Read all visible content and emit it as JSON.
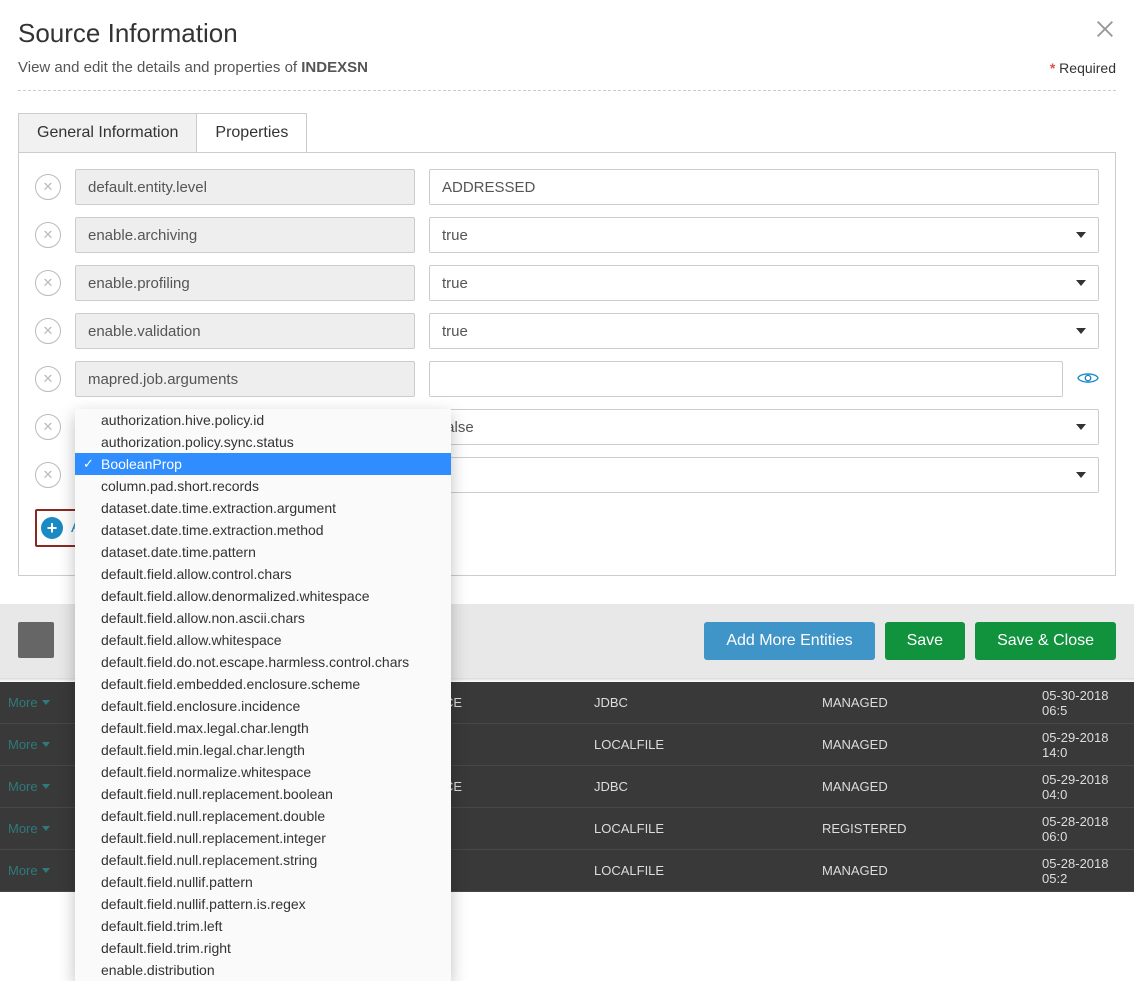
{
  "header": {
    "title": "Source Information",
    "subtitle_prefix": "View and edit the details and properties of ",
    "entity_name": "INDEXSN",
    "required_label": "Required"
  },
  "tabs": {
    "general": "General Information",
    "properties": "Properties"
  },
  "properties": [
    {
      "key": "default.entity.level",
      "value": "ADDRESSED",
      "type": "text"
    },
    {
      "key": "enable.archiving",
      "value": "true",
      "type": "select"
    },
    {
      "key": "enable.profiling",
      "value": "true",
      "type": "select"
    },
    {
      "key": "enable.validation",
      "value": "true",
      "type": "select"
    },
    {
      "key": "mapred.job.arguments",
      "value": "",
      "type": "secret"
    },
    {
      "key": "",
      "value": "false",
      "type": "select"
    },
    {
      "key": "",
      "value": "",
      "type": "select"
    }
  ],
  "add_property_label": "Add Property",
  "dropdown": {
    "selected": "BooleanProp",
    "options": [
      "authorization.hive.policy.id",
      "authorization.policy.sync.status",
      "BooleanProp",
      "column.pad.short.records",
      "dataset.date.time.extraction.argument",
      "dataset.date.time.extraction.method",
      "dataset.date.time.pattern",
      "default.field.allow.control.chars",
      "default.field.allow.denormalized.whitespace",
      "default.field.allow.non.ascii.chars",
      "default.field.allow.whitespace",
      "default.field.do.not.escape.harmless.control.chars",
      "default.field.embedded.enclosure.scheme",
      "default.field.enclosure.incidence",
      "default.field.max.legal.char.length",
      "default.field.min.legal.char.length",
      "default.field.normalize.whitespace",
      "default.field.null.replacement.boolean",
      "default.field.null.replacement.double",
      "default.field.null.replacement.integer",
      "default.field.null.replacement.string",
      "default.field.nullif.pattern",
      "default.field.nullif.pattern.is.regex",
      "default.field.trim.left",
      "default.field.trim.right",
      "enable.distribution"
    ]
  },
  "footer": {
    "add_more": "Add More Entities",
    "save": "Save",
    "save_close": "Save & Close"
  },
  "bg_rows": [
    {
      "more": "More",
      "a": "",
      "b": "CE",
      "c": "JDBC",
      "d": "MANAGED",
      "e": "05-30-2018 06:5"
    },
    {
      "more": "More",
      "a": "",
      "b": "",
      "c": "LOCALFILE",
      "d": "MANAGED",
      "e": "05-29-2018 14:0"
    },
    {
      "more": "More",
      "a": "",
      "b": "CE",
      "c": "JDBC",
      "d": "MANAGED",
      "e": "05-29-2018 04:0"
    },
    {
      "more": "More",
      "a": "",
      "b": "",
      "c": "LOCALFILE",
      "d": "REGISTERED",
      "e": "05-28-2018 06:0"
    },
    {
      "more": "More",
      "a": "",
      "b": "",
      "c": "LOCALFILE",
      "d": "MANAGED",
      "e": "05-28-2018 05:2"
    }
  ]
}
